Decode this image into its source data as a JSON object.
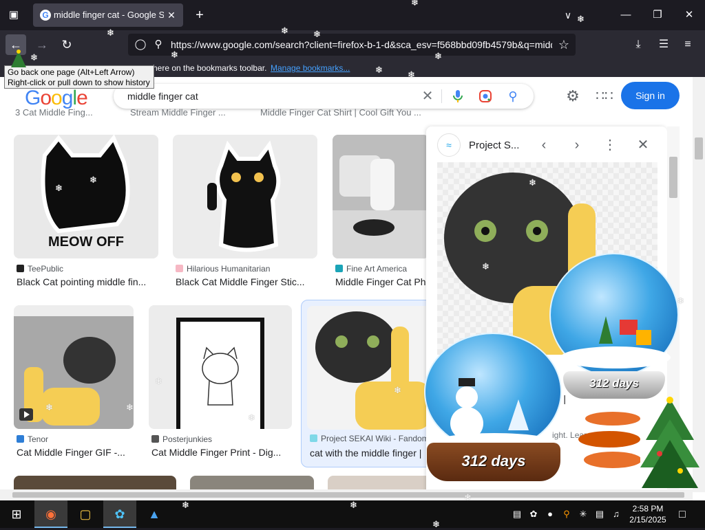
{
  "browser": {
    "tab_title": "middle finger cat - Google Search",
    "url": "https://www.google.com/search?client=firefox-b-1-d&sca_esv=f568bbd09fb4579b&q=middle+finger+cat",
    "tooltip_line1": "Go back one page (Alt+Left Arrow)",
    "tooltip_line2": "Right-click or pull down to show history",
    "bookmarks_text": "here on the bookmarks toolbar.",
    "bookmarks_link": "Manage bookmarks..."
  },
  "google": {
    "logo": [
      "G",
      "o",
      "o",
      "g",
      "l",
      "e"
    ],
    "query": "middle finger cat",
    "sign_in": "Sign in",
    "previous_row": [
      "3  Cat Middle Fing...",
      "Stream Middle Finger ...",
      "Middle Finger Cat Shirt | Cool Gift You ..."
    ]
  },
  "results": [
    {
      "source": "TeePublic",
      "title": "Black Cat pointing middle fin...",
      "image_text": "MEOW OFF"
    },
    {
      "source": "Hilarious Humanitarian",
      "title": "Black Cat Middle Finger Stic..."
    },
    {
      "source": "Fine Art America",
      "title": "Middle Finger Cat Ph"
    },
    {
      "source": "Tenor",
      "title": "Cat Middle Finger GIF -..."
    },
    {
      "source": "Posterjunkies",
      "title": "Cat Middle Finger Print - Dig..."
    },
    {
      "source": "Project SEKAI Wiki - Fandom",
      "title": "cat with the middle finger |"
    }
  ],
  "preview": {
    "source": "Project S...",
    "partial_title": "er |",
    "partial_source": "ight. Lear"
  },
  "decorations": {
    "globe_label": "312 days"
  },
  "taskbar": {
    "time": "2:58 PM",
    "date": "2/15/2025"
  }
}
